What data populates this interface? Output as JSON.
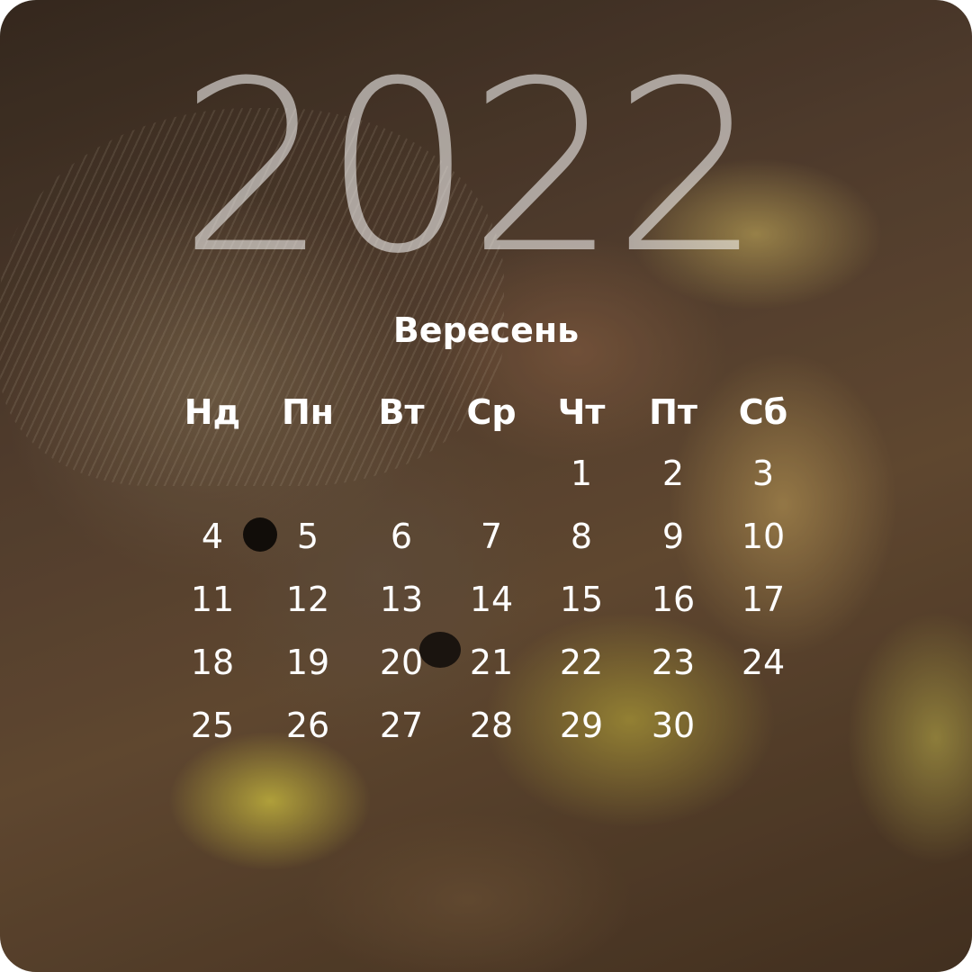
{
  "calendar": {
    "year": "2022",
    "month": "Вересень",
    "weekdays": [
      "Нд",
      "Пн",
      "Вт",
      "Ср",
      "Чт",
      "Пт",
      "Сб"
    ],
    "weeks": [
      [
        "",
        "",
        "",
        "",
        "1",
        "2",
        "3"
      ],
      [
        "4",
        "5",
        "6",
        "7",
        "8",
        "9",
        "10"
      ],
      [
        "11",
        "12",
        "13",
        "14",
        "15",
        "16",
        "17"
      ],
      [
        "18",
        "19",
        "20",
        "21",
        "22",
        "23",
        "24"
      ],
      [
        "25",
        "26",
        "27",
        "28",
        "29",
        "30",
        ""
      ]
    ]
  }
}
